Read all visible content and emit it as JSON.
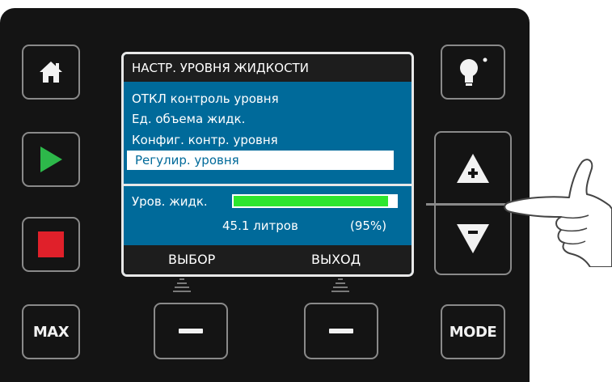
{
  "screen": {
    "title": "НАСТР. УРОВНЯ ЖИДКОСТИ",
    "menu": [
      {
        "label": "ОТКЛ контроль уровня",
        "selected": false
      },
      {
        "label": "Ед. объема жидк.",
        "selected": false
      },
      {
        "label": "Конфиг. контр. уровня",
        "selected": false
      },
      {
        "label": "Регулир. уровня",
        "selected": true
      }
    ],
    "level": {
      "label": "Уров. жидк.",
      "volume": "45.1 литров",
      "percent": "(95%)",
      "fill_fraction": 0.95
    },
    "softkeys": {
      "left": "ВЫБОР",
      "right": "ВЫХОД"
    }
  },
  "buttons": {
    "max_label": "MAX",
    "mode_label": "MODE"
  },
  "icons": [
    "home-icon",
    "play-icon",
    "stop-icon",
    "bulb-icon",
    "plus-up-icon",
    "minus-down-icon",
    "softkey-dash-icon",
    "pointing-hand-icon"
  ],
  "colors": {
    "panel": "#141414",
    "screen_bg": "#006a9a",
    "play": "#2db84a",
    "stop": "#e0202a",
    "level_bar": "#2ee62e"
  }
}
